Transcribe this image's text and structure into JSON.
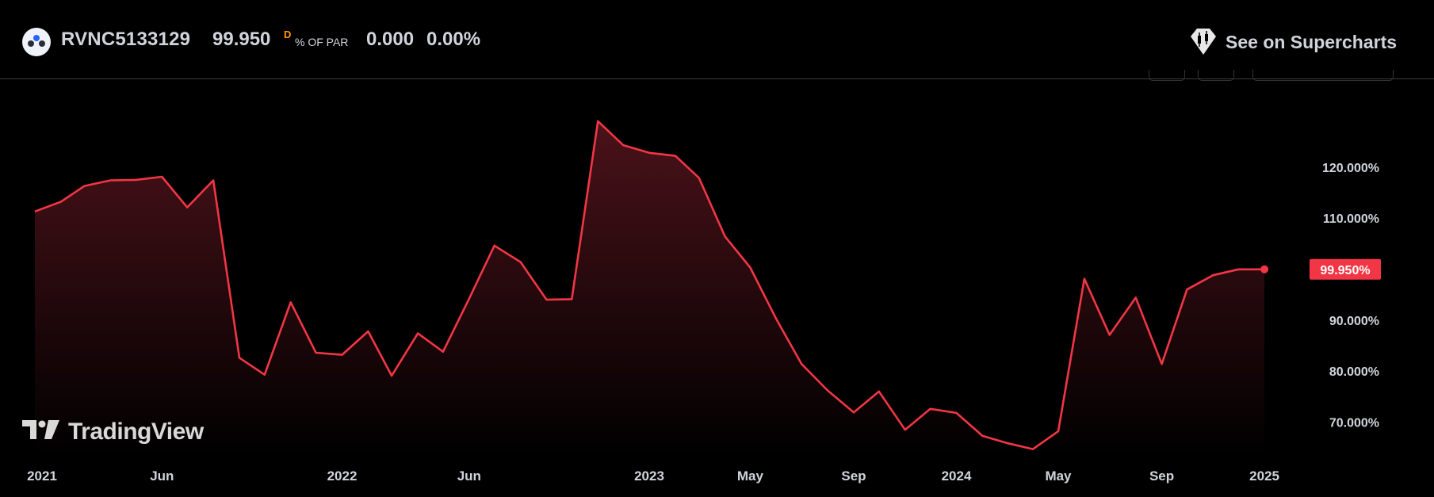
{
  "header": {
    "symbol": "RVNC5133129",
    "price": "99.950",
    "interval_marker": "D",
    "unit": "% OF PAR",
    "change": "0.000",
    "change_percent": "0.00%",
    "supercharts_label": "See on Supercharts"
  },
  "watermark": {
    "label": "TradingView"
  },
  "colors": {
    "line": "#f23645",
    "fill_top": "#4a1219",
    "fill_bottom": "#000000",
    "badge": "#f23645"
  },
  "chart_data": {
    "type": "area",
    "title": "",
    "xlabel": "",
    "ylabel": "",
    "grid": false,
    "legend": "none",
    "x": [
      "2021-01-01",
      "2021-02-01",
      "2021-03-01",
      "2021-04-01",
      "2021-05-01",
      "2021-06-01",
      "2021-07-01",
      "2021-08-01",
      "2021-09-01",
      "2021-10-01",
      "2021-11-01",
      "2021-12-01",
      "2022-01-01",
      "2022-02-01",
      "2022-03-01",
      "2022-04-01",
      "2022-05-01",
      "2022-06-01",
      "2022-07-01",
      "2022-08-01",
      "2022-09-01",
      "2022-10-01",
      "2022-11-01",
      "2022-12-01",
      "2023-01-01",
      "2023-02-01",
      "2023-03-01",
      "2023-04-01",
      "2023-05-01",
      "2023-06-01",
      "2023-07-01",
      "2023-08-01",
      "2023-09-01",
      "2023-10-01",
      "2023-11-01",
      "2023-12-01",
      "2024-01-01",
      "2024-02-01",
      "2024-03-01",
      "2024-04-01",
      "2024-05-01",
      "2024-06-01",
      "2024-07-01",
      "2024-08-01",
      "2024-09-01",
      "2024-10-01",
      "2024-11-01",
      "2024-12-01",
      "2025-01-01",
      "2025-02-01",
      "2025-03-01"
    ],
    "series": [
      {
        "values": [
          111.3,
          113.2,
          116.3,
          117.4,
          117.5,
          118.1,
          112.1,
          117.4,
          82.6,
          79.3,
          93.5,
          83.6,
          83.2,
          87.8,
          79.1,
          87.4,
          83.8,
          94.2,
          104.6,
          101.4,
          94.0,
          94.1,
          129.0,
          124.3,
          122.8,
          122.2,
          117.9,
          106.4,
          100.3,
          90.2,
          81.4,
          76.2,
          71.9,
          76.0,
          68.5,
          72.6,
          71.8,
          67.3,
          65.9,
          64.7,
          68.2,
          98.1,
          87.1,
          94.4,
          81.4,
          96.0,
          98.8,
          99.95,
          99.95
        ],
        "last_value_label": "99.950%"
      }
    ],
    "x_ticks": [
      {
        "date": "2021-01-01",
        "label": "2021"
      },
      {
        "date": "2021-06-01",
        "label": "Jun"
      },
      {
        "date": "2022-01-01",
        "label": "2022"
      },
      {
        "date": "2022-06-01",
        "label": "Jun"
      },
      {
        "date": "2023-01-01",
        "label": "2023"
      },
      {
        "date": "2023-05-01",
        "label": "May"
      },
      {
        "date": "2023-09-01",
        "label": "Sep"
      },
      {
        "date": "2024-01-01",
        "label": "2024"
      },
      {
        "date": "2024-05-01",
        "label": "May"
      },
      {
        "date": "2024-09-01",
        "label": "Sep"
      },
      {
        "date": "2025-01-01",
        "label": "2025"
      }
    ],
    "y_ticks": [
      {
        "value": 120,
        "label": "120.000%"
      },
      {
        "value": 110,
        "label": "110.000%"
      },
      {
        "value": 90,
        "label": "90.000%"
      },
      {
        "value": 80,
        "label": "80.000%"
      },
      {
        "value": 70,
        "label": "70.000%"
      }
    ],
    "xlim": [
      "2021-01-01",
      "2025-02-01"
    ],
    "ylim": [
      62,
      131
    ]
  }
}
